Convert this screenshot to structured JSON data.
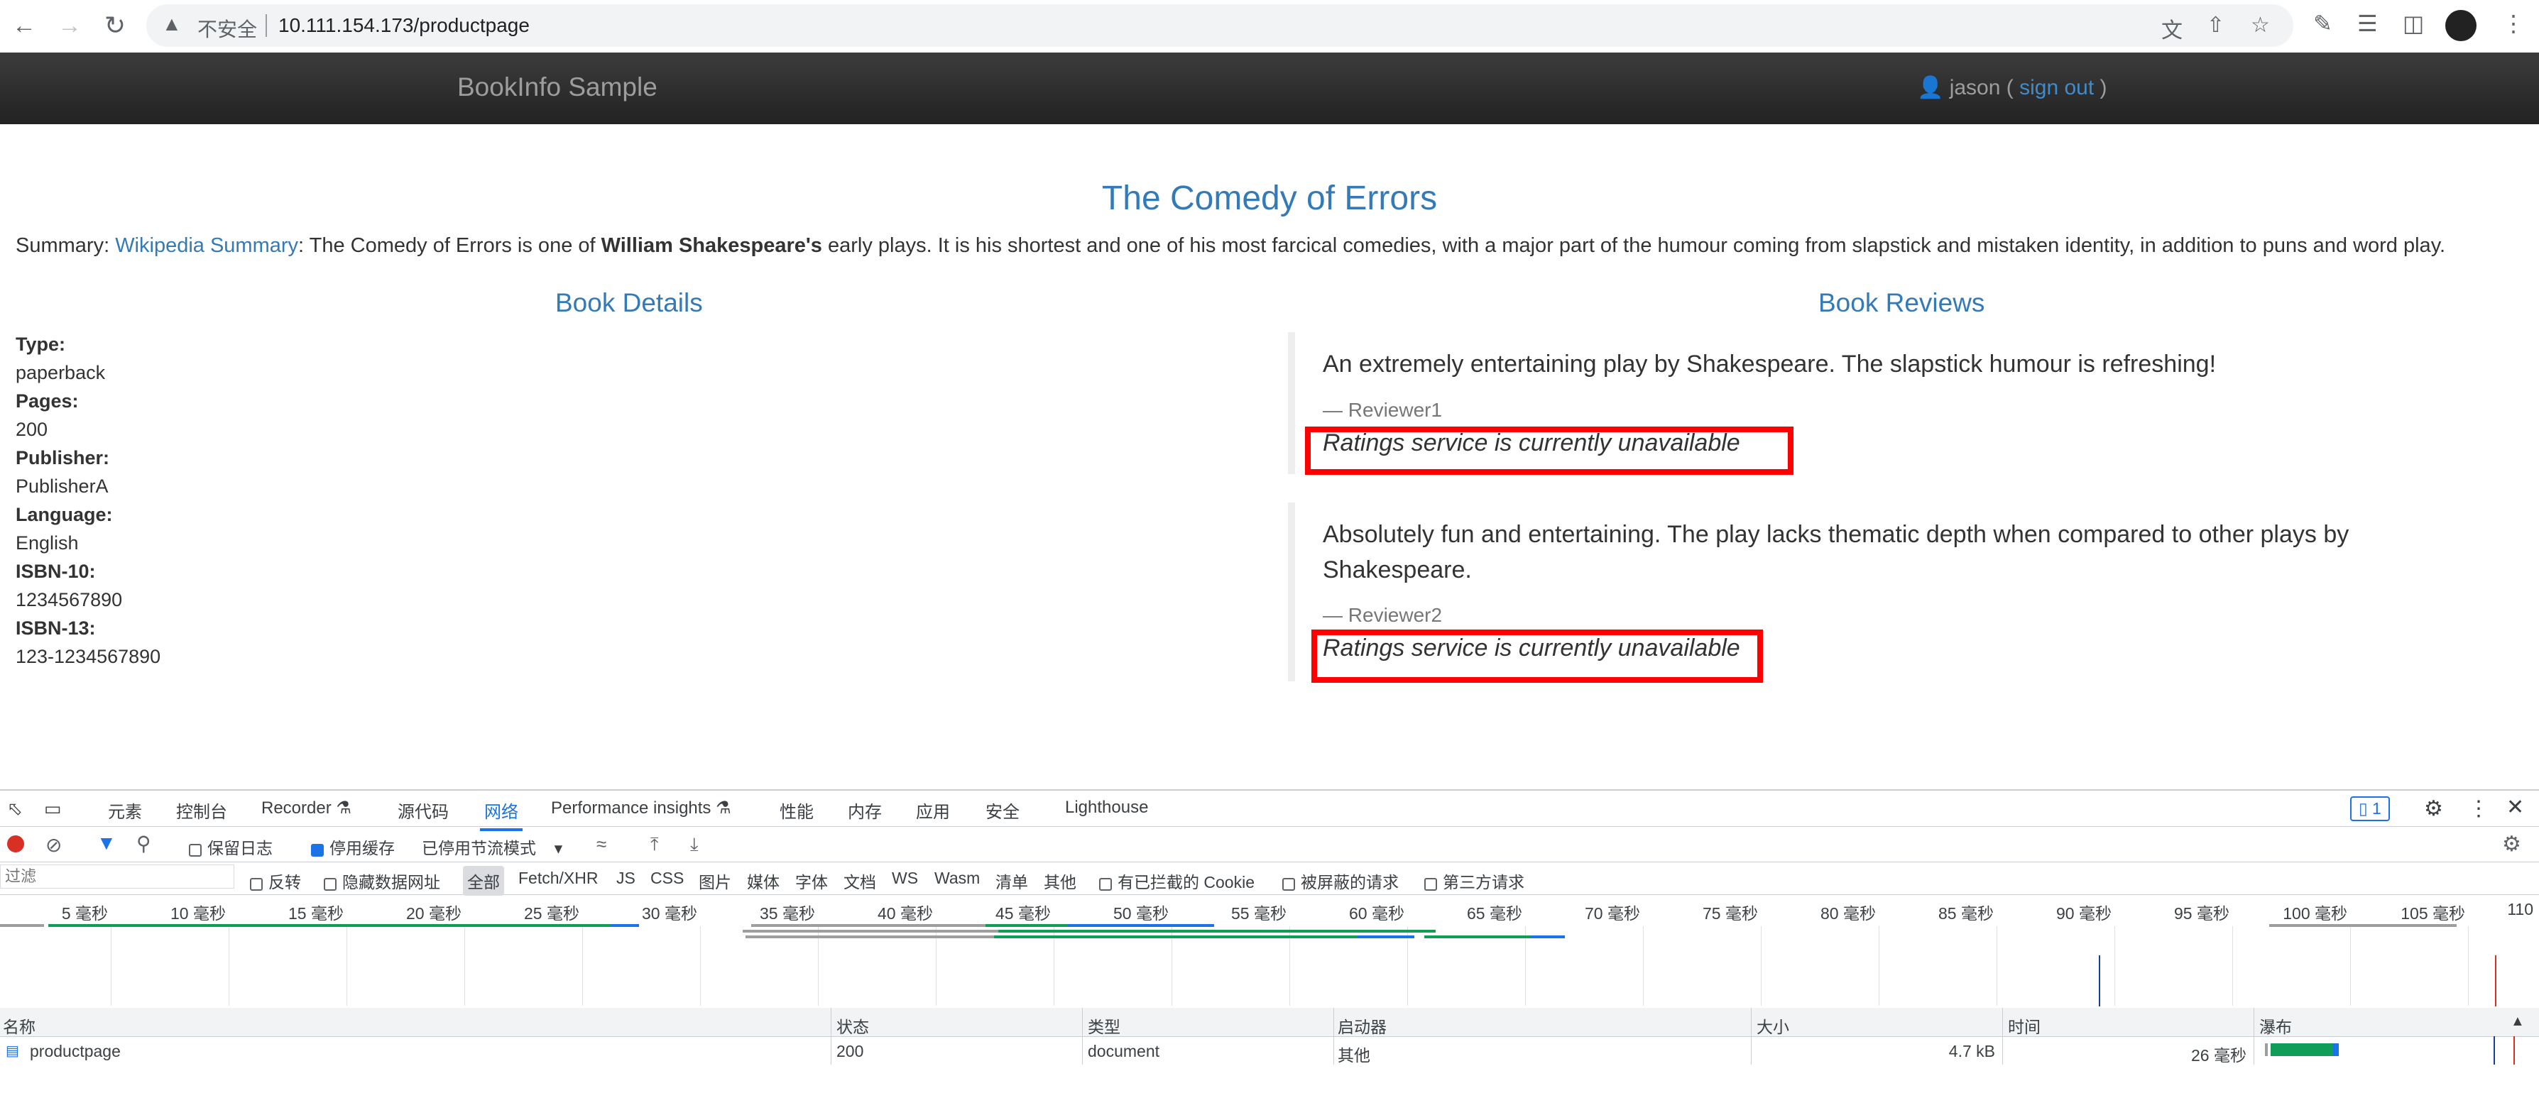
{
  "browser": {
    "insecure_label": "不安全",
    "url": "10.111.154.173/productpage"
  },
  "navbar": {
    "brand": "BookInfo Sample",
    "user_name": "jason (",
    "sign_out": "sign out",
    "user_close": ")"
  },
  "book": {
    "title": "The Comedy of Errors",
    "summary_prefix": "Summary: ",
    "summary_link": "Wikipedia Summary",
    "summary_mid": ": The Comedy of Errors is one of ",
    "summary_bold": "William Shakespeare's",
    "summary_rest": " early plays. It is his shortest and one of his most farcical comedies, with a major part of the humour coming from slapstick and mistaken identity, in addition to puns and word play."
  },
  "details": {
    "heading": "Book Details",
    "items": [
      {
        "label": "Type:",
        "value": "paperback"
      },
      {
        "label": "Pages:",
        "value": "200"
      },
      {
        "label": "Publisher:",
        "value": "PublisherA"
      },
      {
        "label": "Language:",
        "value": "English"
      },
      {
        "label": "ISBN-10:",
        "value": "1234567890"
      },
      {
        "label": "ISBN-13:",
        "value": "123-1234567890"
      }
    ]
  },
  "reviews": {
    "heading": "Book Reviews",
    "items": [
      {
        "text": "An extremely entertaining play by Shakespeare. The slapstick humour is refreshing!",
        "reviewer": "— Reviewer1",
        "rating": "Ratings service is currently unavailable"
      },
      {
        "text": "Absolutely fun and entertaining. The play lacks thematic depth when compared to other plays by Shakespeare.",
        "reviewer": "— Reviewer2",
        "rating": "Ratings service is currently unavailable"
      }
    ]
  },
  "devtools": {
    "tabs": [
      "元素",
      "控制台",
      "Recorder ⚗",
      "源代码",
      "网络",
      "Performance insights ⚗",
      "性能",
      "内存",
      "应用",
      "安全",
      "Lighthouse"
    ],
    "active_tab": "网络",
    "issues_count": "1",
    "toolbar": {
      "preserve_log": "保留日志",
      "disable_cache": "停用缓存",
      "throttle": "已停用节流模式"
    },
    "filter": {
      "placeholder": "过滤",
      "invert": "反转",
      "hide_data_urls": "隐藏数据网址",
      "types": [
        "全部",
        "Fetch/XHR",
        "JS",
        "CSS",
        "图片",
        "媒体",
        "字体",
        "文档",
        "WS",
        "Wasm",
        "清单",
        "其他"
      ],
      "blocked_cookies": "有已拦截的 Cookie",
      "blocked_requests": "被屏蔽的请求",
      "third_party": "第三方请求"
    },
    "timeline_ticks": [
      "5 毫秒",
      "10 毫秒",
      "15 毫秒",
      "20 毫秒",
      "25 毫秒",
      "30 毫秒",
      "35 毫秒",
      "40 毫秒",
      "45 毫秒",
      "50 毫秒",
      "55 毫秒",
      "60 毫秒",
      "65 毫秒",
      "70 毫秒",
      "75 毫秒",
      "80 毫秒",
      "85 毫秒",
      "90 毫秒",
      "95 毫秒",
      "100 毫秒",
      "105 毫秒",
      "110"
    ],
    "columns": [
      "名称",
      "状态",
      "类型",
      "启动器",
      "大小",
      "时间",
      "瀑布"
    ],
    "row": {
      "name": "productpage",
      "status": "200",
      "type": "document",
      "initiator": "其他",
      "size": "4.7 kB",
      "time": "26 毫秒"
    }
  }
}
